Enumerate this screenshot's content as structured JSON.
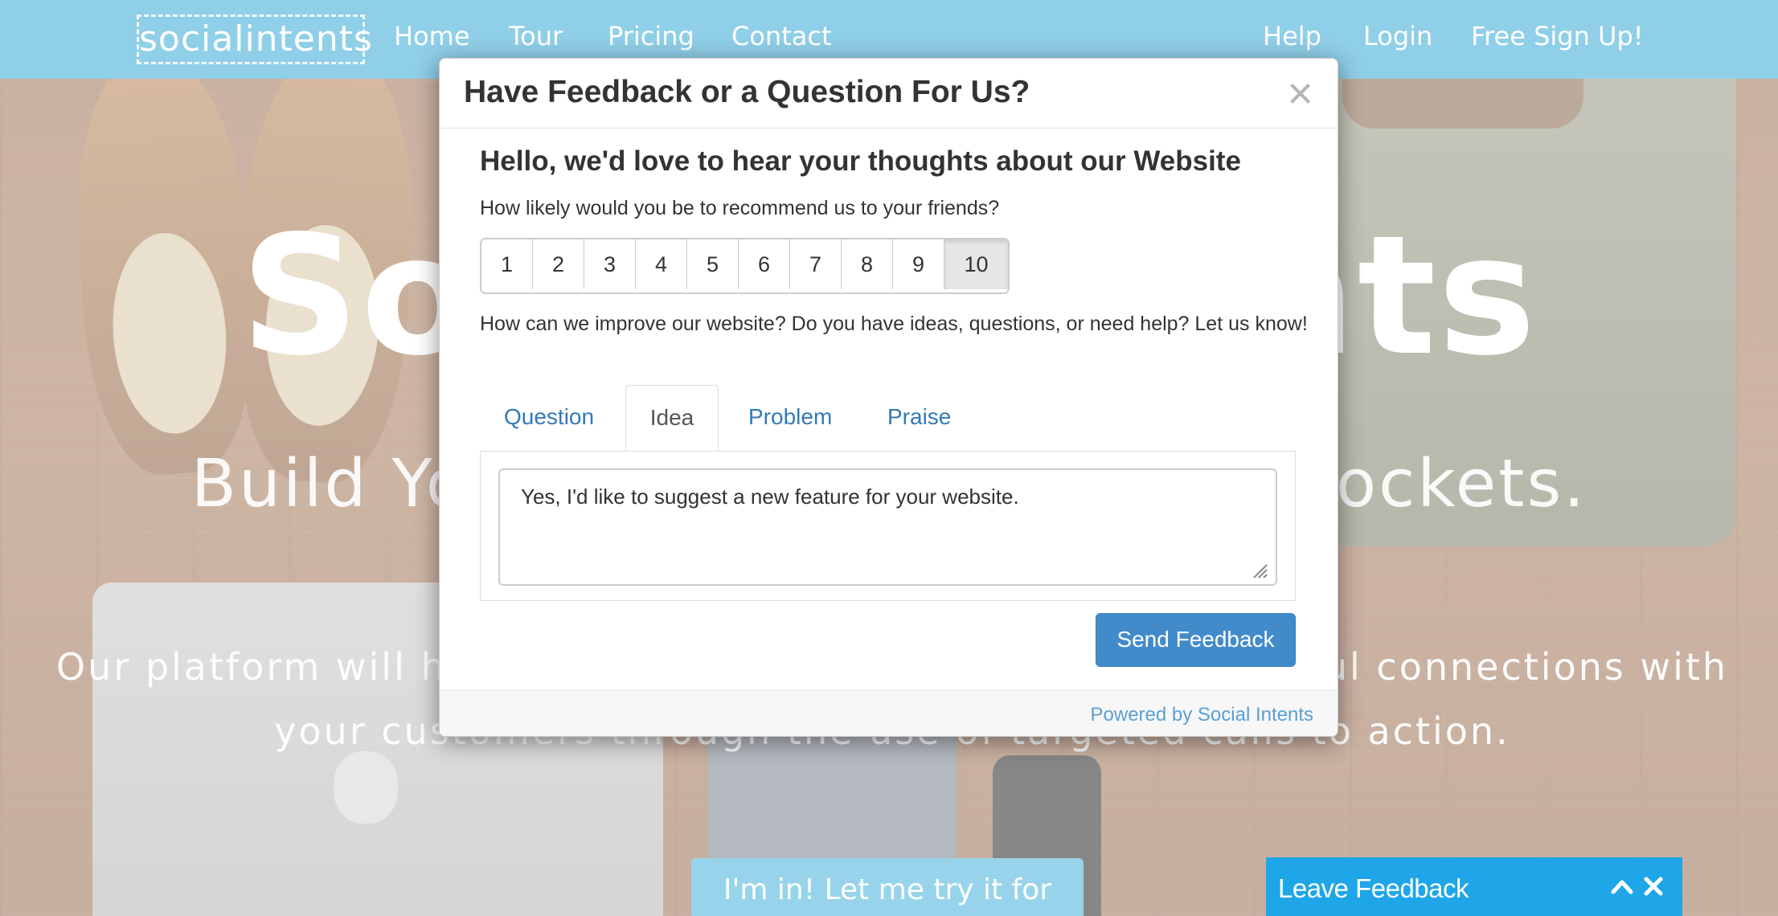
{
  "nav": {
    "logo": "socialintents",
    "links": [
      "Home",
      "Tour",
      "Pricing",
      "Contact"
    ],
    "right_links": [
      "Help",
      "Login",
      "Free Sign Up!"
    ]
  },
  "hero": {
    "title": "Social Intents",
    "subtitle": "Build Your Brand and Line Your Pockets.",
    "description": "Our platform will help you create deeper and more meaningful connections with your customers through the use of targeted calls to action.",
    "cta": "I'm in! Let me try it for Free!"
  },
  "modal": {
    "title": "Have Feedback or a Question For Us?",
    "close": "×",
    "greeting": "Hello, we'd love to hear your thoughts about our Website",
    "recommend_question": "How likely would you be to recommend us to your friends?",
    "ratings": [
      "1",
      "2",
      "3",
      "4",
      "5",
      "6",
      "7",
      "8",
      "9",
      "10"
    ],
    "selected_rating": "10",
    "improve_question": "How can we improve our website? Do you have ideas, questions, or need help? Let us know!",
    "tabs": [
      "Question",
      "Idea",
      "Problem",
      "Praise"
    ],
    "active_tab": "Idea",
    "feedback_text": "Yes, I'd like to suggest a new feature for your website.",
    "send_label": "Send Feedback",
    "powered_by": "Powered by Social Intents"
  },
  "feedback_bar": {
    "label": "Leave Feedback",
    "icons": [
      "chevron-up-icon",
      "close-icon"
    ]
  },
  "colors": {
    "nav_bg": "#66bde0",
    "primary_button": "#428bca",
    "feedback_bar": "#1fa6e8",
    "link": "#337ab7"
  }
}
